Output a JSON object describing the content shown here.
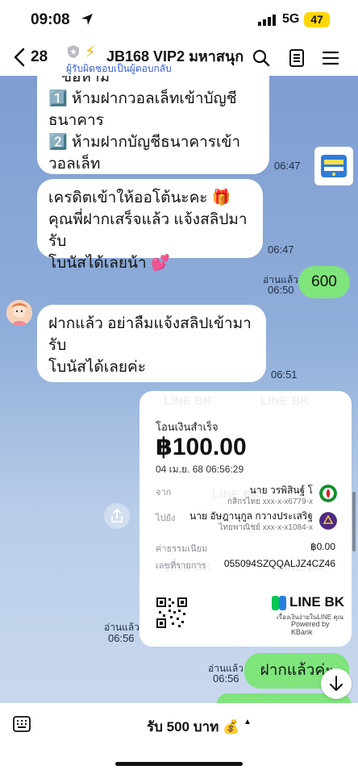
{
  "status": {
    "time": "09:08",
    "network": "5G",
    "battery": "47"
  },
  "header": {
    "unread_count": "28",
    "title": "JB168 VIP2 มหาสนุก",
    "subtitle": "ผู้รับผิดชอบเป็นผู้ตอบกลับ",
    "icons": [
      "back-icon",
      "shield-icon",
      "bolt-icon",
      "search-icon",
      "notes-icon",
      "menu-icon"
    ]
  },
  "messages": {
    "m1": {
      "line0": "ข้อห้าม",
      "line1": "1️⃣ ห้ามฝากวอลเล็ทเข้าบัญชี",
      "line2": "ธนาคาร",
      "line3": "2️⃣ ห้ามฝากบัญชีธนาคารเข้า",
      "line4": "วอลเล็ท",
      "time": "06:47"
    },
    "m2": {
      "line1": "เครดิตเข้าให้ออโต้นะคะ 🎁",
      "line2": "คุณพี่ฝากเสร็จแล้ว แจ้งสลิปมารับ",
      "line3": "โบนัสได้เลยน้า 💕",
      "time": "06:47"
    },
    "m3": {
      "text": "600",
      "read": "อ่านแล้ว",
      "time": "06:50"
    },
    "m4": {
      "line1": "ฝากแล้ว อย่าลืมแจ้งสลิปเข้ามารับ",
      "line2": "โบนัสได้เลยค่ะ",
      "time": "06:51"
    },
    "m5": {
      "read": "อ่านแล้ว",
      "time": "06:56"
    },
    "m6": {
      "text": "ฝากแล้วค่ะ",
      "read": "อ่านแล้ว",
      "time": "06:56"
    }
  },
  "receipt": {
    "title": "โอนเงินสำเร็จ",
    "amount": "฿100.00",
    "date": "04 เม.ย. 68 06:56:29",
    "from_label": "จาก",
    "from_name": "นาย วรพิสินฐ์ โ",
    "from_account": "กสิกรไทย xxx-x-x6779-x",
    "to_label": "ไปยัง",
    "to_name": "นาย อัษฎานุกูล กวางประเสริฐ",
    "to_account": "ไทยพาณิชย์ xxx-x-x1084-x",
    "fee_label": "ค่าธรรมเนียม",
    "fee": "฿0.00",
    "ref_label": "เลขที่รายการ",
    "ref": "055094SZQQALJZ4CZ46",
    "brand": "LINE BK",
    "brand_sub": "เรื่องเงินง่ายในLINE คุณ",
    "powered": "Powered by KBank",
    "watermark": "LINE BK"
  },
  "footer": {
    "menu_label": "รับ 500 บาท 💰",
    "caret": "▲"
  },
  "colors": {
    "chat_bg": "#8aa7d6",
    "sent_bubble": "#7ee47b",
    "accent_link": "#3a60d4"
  }
}
